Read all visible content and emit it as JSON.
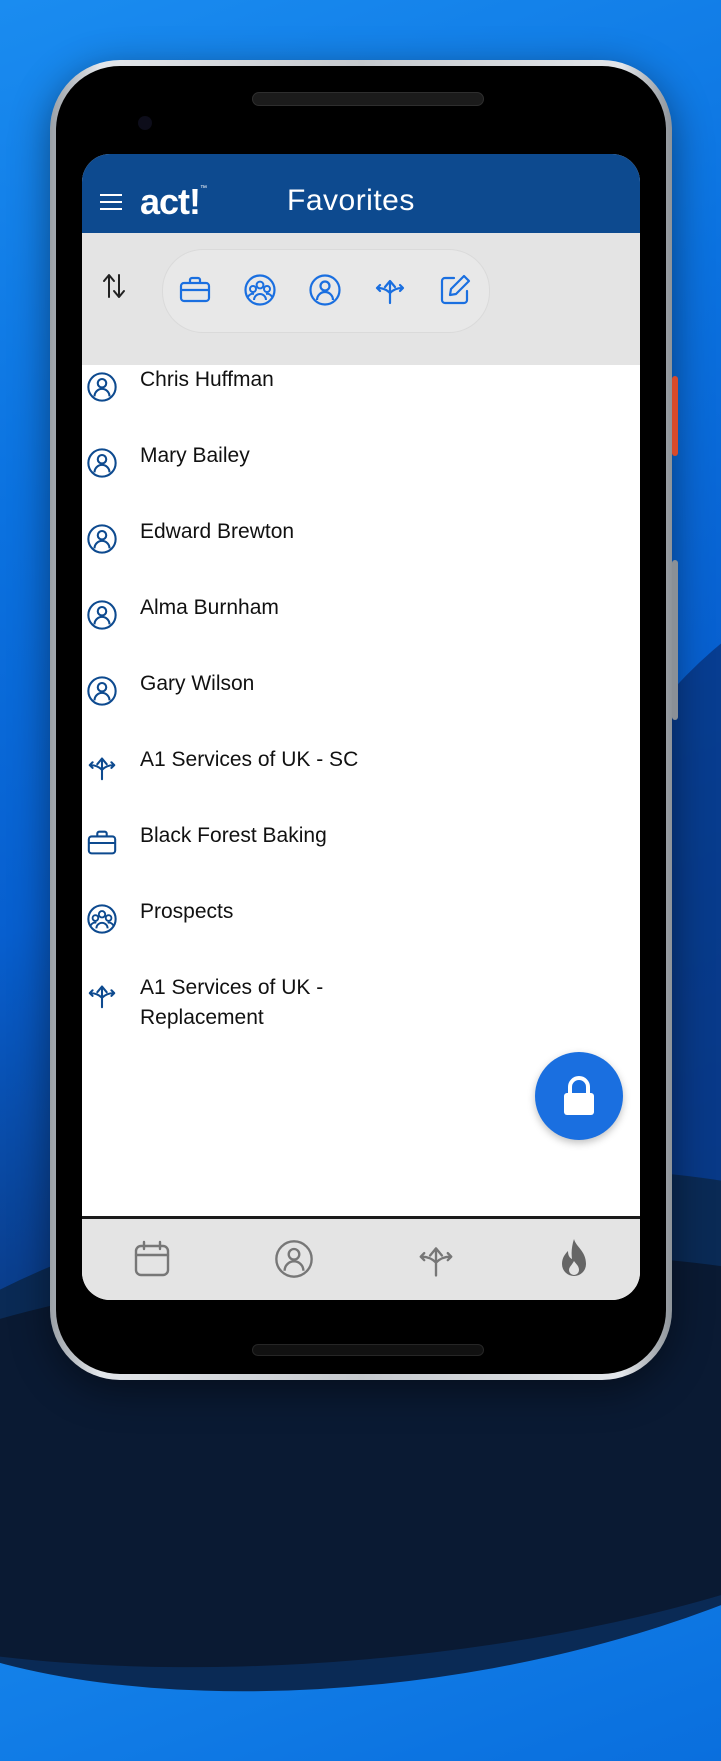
{
  "app": {
    "logo_text": "act!",
    "logo_tm": "™",
    "title": "Favorites"
  },
  "toolbar": {
    "sort_icon": "sort-arrows-icon",
    "filters": [
      {
        "name": "companies",
        "icon": "briefcase-icon"
      },
      {
        "name": "groups",
        "icon": "group-icon"
      },
      {
        "name": "contacts",
        "icon": "contact-icon"
      },
      {
        "name": "opportunities",
        "icon": "opportunity-icon"
      },
      {
        "name": "notes",
        "icon": "edit-icon"
      }
    ]
  },
  "favorites": [
    {
      "label": "Chris Huffman",
      "icon": "contact-icon"
    },
    {
      "label": "Mary Bailey",
      "icon": "contact-icon"
    },
    {
      "label": "Edward Brewton",
      "icon": "contact-icon"
    },
    {
      "label": "Alma Burnham",
      "icon": "contact-icon"
    },
    {
      "label": "Gary Wilson",
      "icon": "contact-icon"
    },
    {
      "label": "A1 Services of UK - SC",
      "icon": "opportunity-icon"
    },
    {
      "label": "Black Forest Baking",
      "icon": "briefcase-icon"
    },
    {
      "label": "Prospects",
      "icon": "group-icon"
    },
    {
      "label": "A1 Services of UK -\nReplacement",
      "icon": "opportunity-icon"
    }
  ],
  "fab": {
    "icon": "lock-icon"
  },
  "bottom_nav": [
    {
      "name": "calendar",
      "icon": "calendar-icon"
    },
    {
      "name": "contacts",
      "icon": "contact-icon"
    },
    {
      "name": "opportunities",
      "icon": "opportunity-icon"
    },
    {
      "name": "hot",
      "icon": "flame-icon"
    }
  ],
  "colors": {
    "appbar": "#0d4a8f",
    "accent": "#1a6fe0",
    "list_icon": "#0d4a8f"
  }
}
